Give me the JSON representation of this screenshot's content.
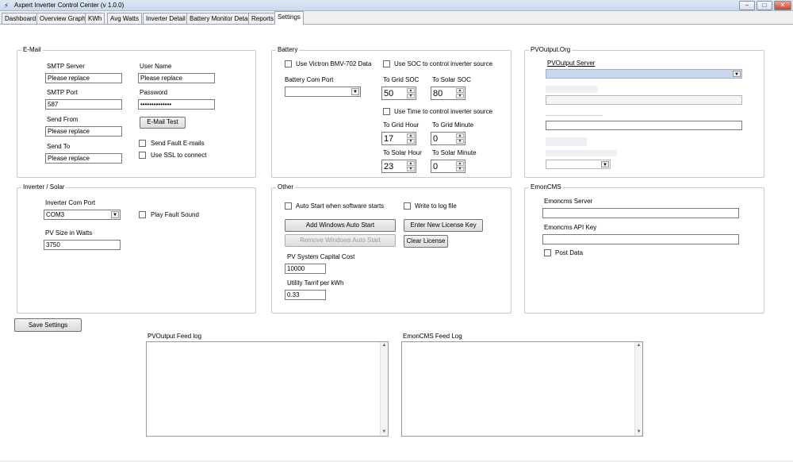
{
  "window": {
    "title": "Axpert Inverter Control Center  (v 1.0.0)",
    "minimize": "–",
    "maximize": "□",
    "close": "✕"
  },
  "tabs": [
    "Dashboard",
    "Overview Graph",
    "KWh",
    "Avg Watts",
    "Inverter Detail",
    "Battery Monitor Detail",
    "Reports",
    "Settings"
  ],
  "email": {
    "title": "E-Mail",
    "smtp_server_label": "SMTP Server",
    "smtp_server_value": "Please replace",
    "smtp_port_label": "SMTP Port",
    "smtp_port_value": "587",
    "send_from_label": "Send From",
    "send_from_value": "Please replace",
    "send_to_label": "Send To",
    "send_to_value": "Please replace",
    "username_label": "User Name",
    "username_value": "Please replace",
    "password_label": "Password",
    "password_value": "••••••••••••••",
    "test_button": "E-Mail Test",
    "send_fault_label": "Send Fault E-mails",
    "use_ssl_label": "Use SSL to connect"
  },
  "battery": {
    "title": "Battery",
    "victron_label": "Use Victron BMV-702 Data",
    "com_port_label": "Battery Com Port",
    "com_port_value": "",
    "use_soc_label": "Use SOC to control inverter source",
    "to_grid_soc_label": "To Grid SOC",
    "to_grid_soc_value": "50",
    "to_solar_soc_label": "To Solar SOC",
    "to_solar_soc_value": "80",
    "use_time_label": "Use Time to control inverter source",
    "to_grid_hour_label": "To Grid Hour",
    "to_grid_hour_value": "17",
    "to_grid_minute_label": "To Grid Minute",
    "to_grid_minute_value": "0",
    "to_solar_hour_label": "To Solar Hour",
    "to_solar_hour_value": "23",
    "to_solar_minute_label": "To Solar Minute",
    "to_solar_minute_value": "0"
  },
  "pvoutput": {
    "title": "PVOutput.Org",
    "server_label": "PVOutput Server"
  },
  "inverter": {
    "title": "Inverter / Solar",
    "com_port_label": "Inverter Com Port",
    "com_port_value": "COM3",
    "play_fault_label": "Play Fault Sound",
    "pv_size_label": "PV Size in Watts",
    "pv_size_value": "3750"
  },
  "other": {
    "title": "Other",
    "auto_start_label": "Auto Start  when software starts",
    "write_log_label": "Write to log file",
    "add_auto_start": "Add Windows Auto Start",
    "remove_auto_start": "Remove Windows Auto Start",
    "enter_license": "Enter New License Key",
    "clear_license": "Clear License",
    "capital_cost_label": "PV System Capital Cost",
    "capital_cost_value": "10000",
    "tariff_label": "Utility Tarrif per kWh",
    "tariff_value": "0.33"
  },
  "emoncms": {
    "title": "EmonCMS",
    "server_label": "Emoncms Server",
    "server_value": "",
    "api_key_label": "Emoncms API Key",
    "api_key_value": "",
    "post_data_label": "Post Data"
  },
  "save_button": "Save Settings",
  "pvoutput_log_label": "PVOutput Feed log",
  "emoncms_log_label": "EmonCMS Feed Log",
  "icons": {
    "dropdown": "▼",
    "spin_up": "▲",
    "spin_down": "▼",
    "app": "⚡"
  }
}
